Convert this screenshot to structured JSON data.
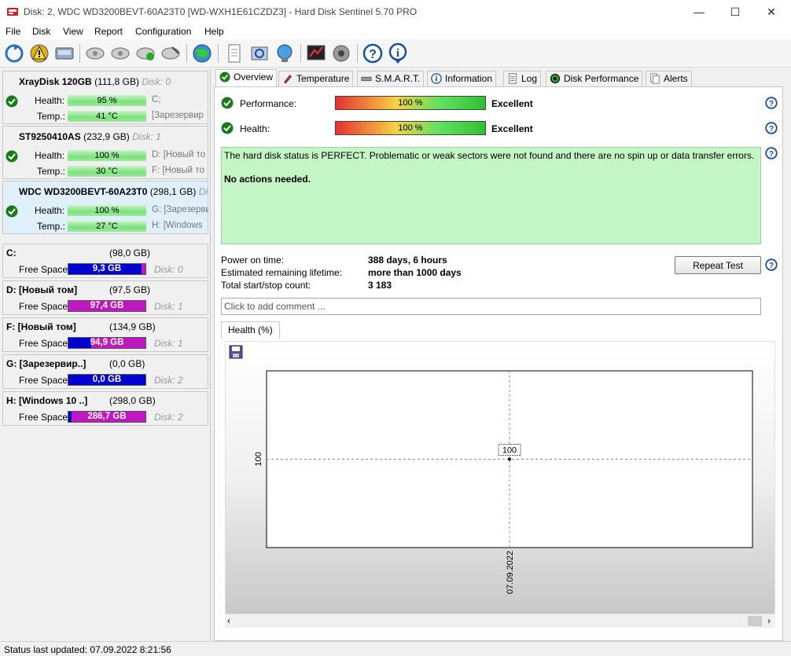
{
  "window": {
    "title": "Disk: 2, WDC WD3200BEVT-60A23T0 [WD-WXH1E61CZDZ3]  -  Hard Disk Sentinel 5.70 PRO",
    "min": "—",
    "max": "☐",
    "close": "✕"
  },
  "menu": [
    "File",
    "Disk",
    "View",
    "Report",
    "Configuration",
    "Help"
  ],
  "toolbar_icons": [
    "refresh-icon",
    "warning-icon",
    "disk-icon",
    "test-1-icon",
    "test-2-icon",
    "test-3-icon",
    "test-4-icon",
    "globe-icon",
    "report-icon",
    "sync-icon",
    "network-icon",
    "benchmark-icon",
    "sound-icon",
    "help-icon",
    "info-icon"
  ],
  "disks": [
    {
      "name": "XrayDisk 120GB",
      "size": "(111,8 GB)",
      "disk": "Disk: 0",
      "health_label": "Health:",
      "health": "95 %",
      "temp_label": "Temp.:",
      "temp": "41 °C",
      "vol1": "C;",
      "vol2": "[Зарезервир",
      "selected": false
    },
    {
      "name": "ST9250410AS",
      "size": "(232,9 GB)",
      "disk": "Disk: 1",
      "health_label": "Health:",
      "health": "100 %",
      "temp_label": "Temp.:",
      "temp": "30 °C",
      "vol1": "D: [Новый то",
      "vol2": "F: [Новый то",
      "selected": false
    },
    {
      "name": "WDC WD3200BEVT-60A23T0",
      "size": "(298,1 GB)",
      "disk": "Di",
      "health_label": "Health:",
      "health": "100 %",
      "temp_label": "Temp.:",
      "temp": "27 °C",
      "vol1": "G: [Зарезерви",
      "vol2": "H: [Windows",
      "selected": true
    }
  ],
  "volumes": [
    {
      "name": "C:",
      "size": "(98,0 GB)",
      "free_label": "Free Space",
      "free": "9,3 GB",
      "free_ratio": 0.95,
      "disk": "Disk: 0"
    },
    {
      "name": "D: [Новый том]",
      "size": "(97,5 GB)",
      "free_label": "Free Space",
      "free": "97,4 GB",
      "free_ratio": 0.0,
      "disk": "Disk: 1"
    },
    {
      "name": "F: [Новый том]",
      "size": "(134,9 GB)",
      "free_label": "Free Space",
      "free": "94,9 GB",
      "free_ratio": 0.3,
      "disk": "Disk: 1"
    },
    {
      "name": "G: [Зарезервир..]",
      "size": "(0,0 GB)",
      "free_label": "Free Space",
      "free": "0,0 GB",
      "free_ratio": 1.0,
      "disk": "Disk: 2"
    },
    {
      "name": "H: [Windows 10 ..]",
      "size": "(298,0 GB)",
      "free_label": "Free Space",
      "free": "286,7 GB",
      "free_ratio": 0.04,
      "disk": "Disk: 2"
    }
  ],
  "tabs": [
    {
      "label": "Overview",
      "icon": "check-icon",
      "active": true
    },
    {
      "label": "Temperature",
      "icon": "thermometer-icon",
      "active": false
    },
    {
      "label": "S.M.A.R.T.",
      "icon": "disk-small-icon",
      "active": false
    },
    {
      "label": "Information",
      "icon": "info-small-icon",
      "active": false
    },
    {
      "label": "Log",
      "icon": "log-icon",
      "active": false
    },
    {
      "label": "Disk Performance",
      "icon": "gauge-icon",
      "active": false
    },
    {
      "label": "Alerts",
      "icon": "alerts-icon",
      "active": false
    }
  ],
  "overview": {
    "performance_label": "Performance:",
    "performance_value": "100 %",
    "performance_rating": "Excellent",
    "health_label": "Health:",
    "health_value": "100 %",
    "health_rating": "Excellent",
    "status_text": "The hard disk status is PERFECT. Problematic or weak sectors were not found and there are no spin up or data transfer errors.",
    "action_text": "No actions needed.",
    "power_on_label": "Power on time:",
    "power_on_value": "388 days, 6 hours",
    "lifetime_label": "Estimated remaining lifetime:",
    "lifetime_value": "more than 1000 days",
    "startstop_label": "Total start/stop count:",
    "startstop_value": "3 183",
    "repeat_test": "Repeat Test",
    "comment_placeholder": "Click to add comment ..."
  },
  "chart_tab": "Health (%)",
  "chart_data": {
    "type": "line",
    "x": [
      "07.09.2022"
    ],
    "values": [
      100
    ],
    "ylabel": "",
    "xlabel": "",
    "y_tick": "100",
    "point_label": "100",
    "grid": true
  },
  "status": "Status last updated: 07.09.2022 8:21:56",
  "colors": {
    "green_box": "#c4f5c4",
    "volume_used": "#0000d0",
    "volume_free": "#c018c0",
    "selected_disk": "#dff0fb"
  }
}
